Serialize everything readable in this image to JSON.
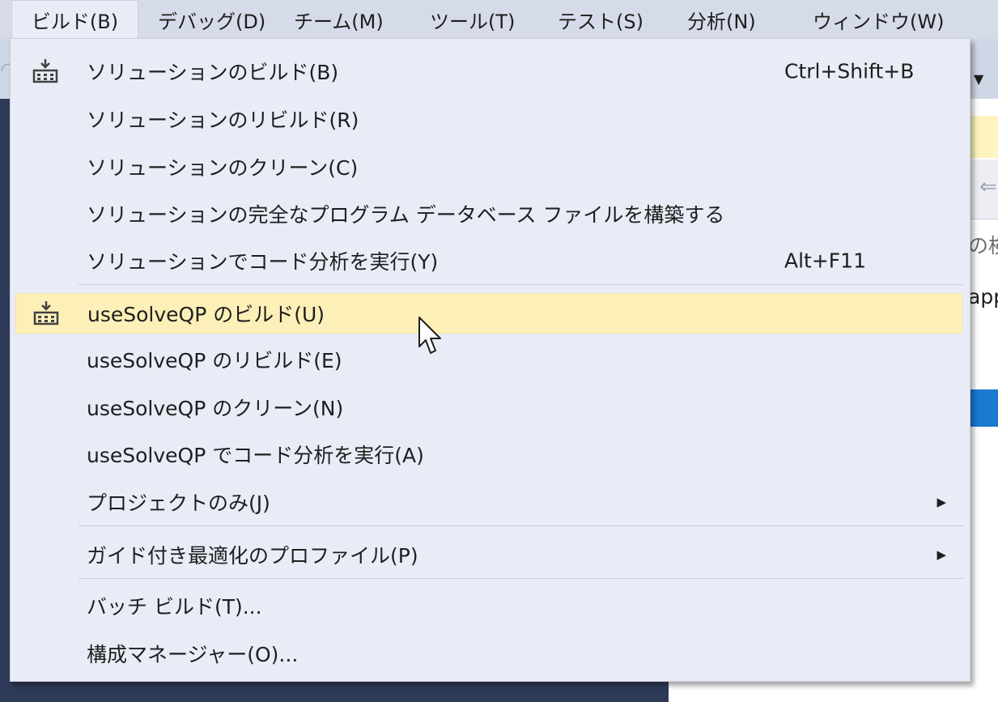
{
  "menubar": {
    "items": [
      {
        "label": "ビルド(B)",
        "active": true
      },
      {
        "label": "デバッグ(D)",
        "active": false
      },
      {
        "label": "チーム(M)",
        "active": false
      },
      {
        "label": "ツール(T)",
        "active": false
      },
      {
        "label": "テスト(S)",
        "active": false
      },
      {
        "label": "分析(N)",
        "active": false
      },
      {
        "label": "ウィンドウ(W)",
        "active": false
      }
    ]
  },
  "build_menu": {
    "items": [
      {
        "label": "ソリューションのビルド(B)",
        "shortcut": "Ctrl+Shift+B",
        "icon": "build-icon",
        "submenu": false,
        "highlighted": false
      },
      {
        "label": "ソリューションのリビルド(R)",
        "shortcut": "",
        "icon": "",
        "submenu": false,
        "highlighted": false
      },
      {
        "label": "ソリューションのクリーン(C)",
        "shortcut": "",
        "icon": "",
        "submenu": false,
        "highlighted": false
      },
      {
        "label": "ソリューションの完全なプログラム データベース ファイルを構築する",
        "shortcut": "",
        "icon": "",
        "submenu": false,
        "highlighted": false
      },
      {
        "label": "ソリューションでコード分析を実行(Y)",
        "shortcut": "Alt+F11",
        "icon": "",
        "submenu": false,
        "highlighted": false
      },
      {
        "label": "useSolveQP のビルド(U)",
        "shortcut": "",
        "icon": "build-icon",
        "submenu": false,
        "highlighted": true
      },
      {
        "label": "useSolveQP のリビルド(E)",
        "shortcut": "",
        "icon": "",
        "submenu": false,
        "highlighted": false
      },
      {
        "label": "useSolveQP のクリーン(N)",
        "shortcut": "",
        "icon": "",
        "submenu": false,
        "highlighted": false
      },
      {
        "label": "useSolveQP でコード分析を実行(A)",
        "shortcut": "",
        "icon": "",
        "submenu": false,
        "highlighted": false
      },
      {
        "label": "プロジェクトのみ(J)",
        "shortcut": "",
        "icon": "",
        "submenu": true,
        "highlighted": false
      },
      {
        "label": "ガイド付き最適化のプロファイル(P)",
        "shortcut": "",
        "icon": "",
        "submenu": true,
        "highlighted": false
      },
      {
        "label": "バッチ ビルド(T)...",
        "shortcut": "",
        "icon": "",
        "submenu": false,
        "highlighted": false
      },
      {
        "label": "構成マネージャー(O)...",
        "shortcut": "",
        "icon": "",
        "submenu": false,
        "highlighted": false
      }
    ]
  },
  "background": {
    "search_fragment": "の検",
    "app_fragment": "app"
  },
  "colors": {
    "menubar_bg": "#d6dbe9",
    "menu_bg": "#e9ecf6",
    "highlight_bg": "#fcf0b8",
    "accent_blue": "#1c79d1",
    "dark_bg": "#2d3a58"
  }
}
